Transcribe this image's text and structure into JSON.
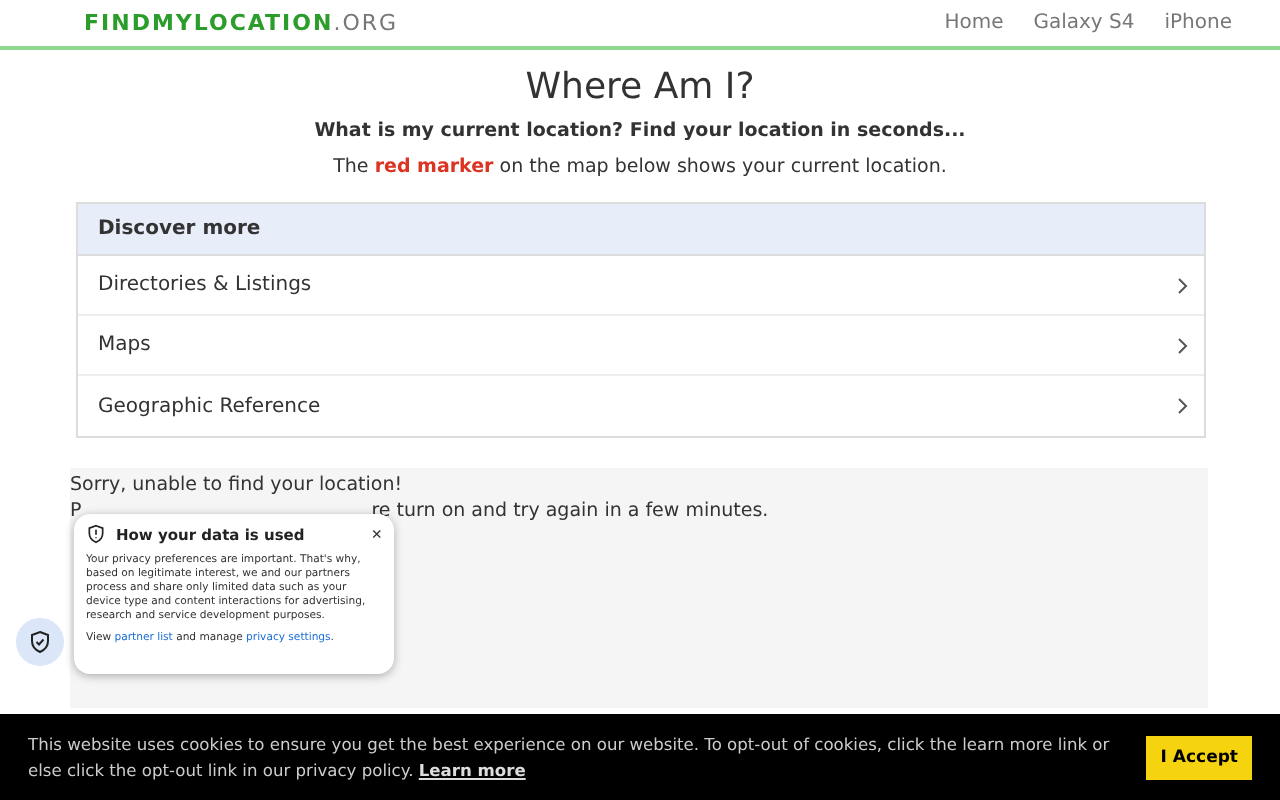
{
  "header": {
    "logo_main": "FINDMYLOCATION",
    "logo_suffix": ".ORG",
    "nav": [
      "Home",
      "Galaxy S4",
      "iPhone"
    ]
  },
  "title": "Where Am I?",
  "subtitle": "What is my current location? Find your location in seconds...",
  "intro": "The **red marker** on the map below shows your current location.",
  "accordion": {
    "heading": "Discover more",
    "items": [
      "Directories & Listings",
      "Maps",
      "Geographic Reference"
    ]
  },
  "status": {
    "line_1": "Sorry, unable to find your location!",
    "line_2_start": "P",
    "line_2_end": "re turn on and try again in a few minutes."
  },
  "privacy_popup": {
    "title": "How your data is used",
    "close": "×",
    "body": "Your privacy preferences are important. That's why, based on legitimate interest, we and our partners process and share only limited data such as your device type and content interactions for advertising, research and service development purposes.",
    "footer_before": "View",
    "partner_link": "partner list",
    "footer_middle": "and manage",
    "settings_link": "privacy settings",
    "footer_after": "."
  },
  "cookie_bar": {
    "text": "This website uses cookies to ensure you get the best experience on our website. To opt-out of cookies, click the learn more link or else click the opt-out link in our privacy policy.",
    "link": "Learn more",
    "button": "I Accept"
  }
}
